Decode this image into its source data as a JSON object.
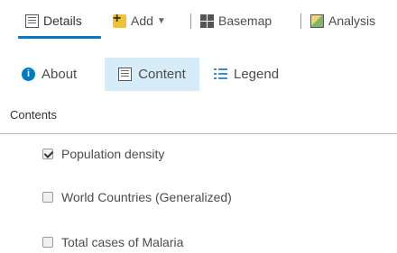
{
  "toolbar": {
    "details_label": "Details",
    "add_label": "Add",
    "basemap_label": "Basemap",
    "analysis_label": "Analysis"
  },
  "subtabs": {
    "about_label": "About",
    "content_label": "Content",
    "legend_label": "Legend"
  },
  "contents": {
    "title": "Contents",
    "layers": [
      {
        "label": "Population density",
        "checked": true
      },
      {
        "label": "World Countries (Generalized)",
        "checked": false
      },
      {
        "label": "Total cases of Malaria",
        "checked": false
      }
    ]
  },
  "colors": {
    "accent": "#007ac2",
    "selected_bg": "#d6ecf9"
  },
  "icons": [
    "details-icon",
    "add-icon",
    "basemap-icon",
    "analysis-icon",
    "info-icon",
    "content-icon",
    "legend-icon"
  ]
}
